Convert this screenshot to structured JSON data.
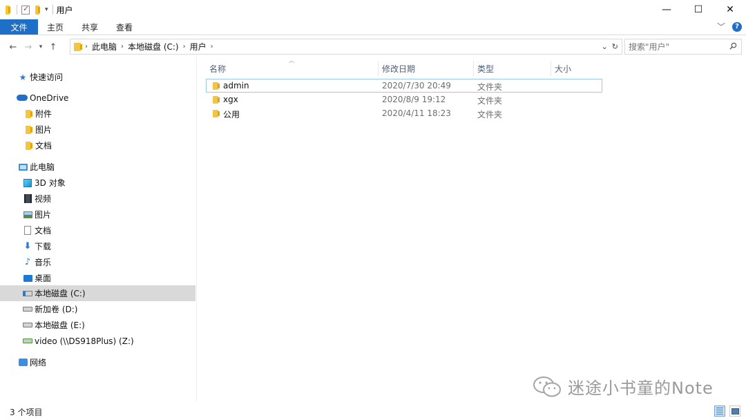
{
  "window": {
    "title": "用户",
    "minimize_glyph": "—",
    "maximize_glyph": "☐",
    "close_glyph": "✕"
  },
  "ribbon": {
    "tabs": [
      "文件",
      "主页",
      "共享",
      "查看"
    ],
    "help_glyph": "?"
  },
  "address": {
    "breadcrumbs": [
      "此电脑",
      "本地磁盘 (C:)",
      "用户"
    ],
    "search_placeholder": "搜索\"用户\""
  },
  "sidebar": {
    "items": [
      {
        "label": "快速访问",
        "icon": "star-icon"
      },
      {
        "label": "OneDrive",
        "icon": "cloud-icon"
      },
      {
        "label": "附件",
        "icon": "folder-icon"
      },
      {
        "label": "图片",
        "icon": "folder-icon"
      },
      {
        "label": "文档",
        "icon": "folder-icon"
      },
      {
        "label": "此电脑",
        "icon": "pc-icon"
      },
      {
        "label": "3D 对象",
        "icon": "cube-icon"
      },
      {
        "label": "视频",
        "icon": "video-icon"
      },
      {
        "label": "图片",
        "icon": "pictures-icon"
      },
      {
        "label": "文档",
        "icon": "documents-icon"
      },
      {
        "label": "下载",
        "icon": "download-icon"
      },
      {
        "label": "音乐",
        "icon": "music-icon"
      },
      {
        "label": "桌面",
        "icon": "desktop-icon"
      },
      {
        "label": "本地磁盘 (C:)",
        "icon": "system-drive-icon",
        "selected": true
      },
      {
        "label": "新加卷 (D:)",
        "icon": "drive-icon"
      },
      {
        "label": "本地磁盘 (E:)",
        "icon": "drive-icon"
      },
      {
        "label": "video (\\\\DS918Plus) (Z:)",
        "icon": "network-drive-icon"
      },
      {
        "label": "网络",
        "icon": "network-icon"
      }
    ]
  },
  "columns": {
    "name": "名称",
    "modified": "修改日期",
    "type": "类型",
    "size": "大小"
  },
  "files": [
    {
      "name": "admin",
      "modified": "2020/7/30 20:49",
      "type": "文件夹"
    },
    {
      "name": "xgx",
      "modified": "2020/8/9 19:12",
      "type": "文件夹"
    },
    {
      "name": "公用",
      "modified": "2020/4/11 18:23",
      "type": "文件夹"
    }
  ],
  "status": {
    "item_count": "3 个项目"
  },
  "watermark": {
    "text": "迷途小书童的Note"
  },
  "colors": {
    "accent": "#1e6fc8",
    "selection": "#d9d9d9",
    "focus_border": "#99c9ef",
    "folder": "#f4c542"
  }
}
